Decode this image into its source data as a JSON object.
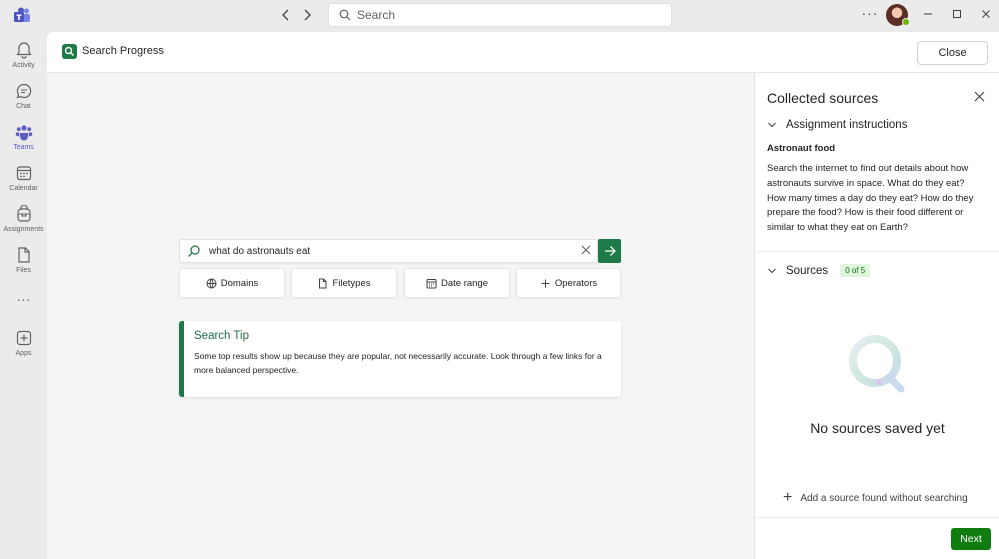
{
  "titlebar": {
    "search_placeholder": "Search"
  },
  "rail": {
    "items": [
      {
        "label": "Activity"
      },
      {
        "label": "Chat"
      },
      {
        "label": "Teams"
      },
      {
        "label": "Calendar"
      },
      {
        "label": "Assignments"
      },
      {
        "label": "Files"
      },
      {
        "label": "Apps"
      }
    ],
    "active": "Teams"
  },
  "app": {
    "title": "Search Progress",
    "close_label": "Close"
  },
  "search": {
    "query": "what do astronauts eat",
    "filters": [
      "Domains",
      "Filetypes",
      "Date range",
      "Operators"
    ]
  },
  "tip": {
    "title": "Search Tip",
    "text": "Some top results show up because they are popular, not necessarily accurate. Look through a few links for a more balanced perspective."
  },
  "panel": {
    "title": "Collected sources",
    "assignment_header": "Assignment instructions",
    "assignment_name": "Astronaut food",
    "assignment_desc": "Search the internet to find out details about how astronauts survive in space. What do they eat? How many times a day do they eat? How do they prepare the food? How is their food different or similar to what they eat on Earth?",
    "sources_header": "Sources",
    "sources_count": "0 of 5",
    "empty_text": "No sources saved yet",
    "add_source_label": "Add a source found without searching",
    "next_label": "Next"
  },
  "colors": {
    "accent_green": "#1f7a4a",
    "next_green": "#107c10",
    "teams_purple": "#5b5fc7"
  }
}
